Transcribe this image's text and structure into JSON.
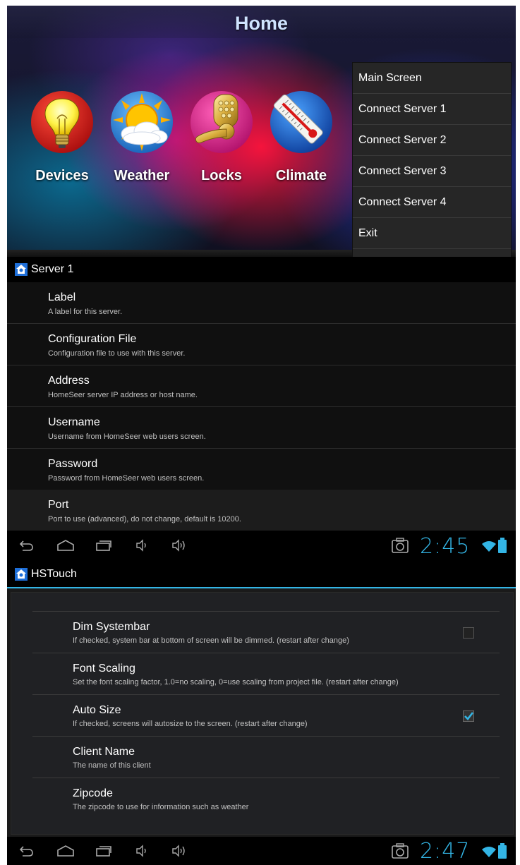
{
  "home": {
    "title": "Home",
    "tiles": [
      {
        "label": "Devices",
        "icon": "lightbulb-icon"
      },
      {
        "label": "Weather",
        "icon": "weather-sun-cloud-icon"
      },
      {
        "label": "Locks",
        "icon": "door-lock-icon"
      },
      {
        "label": "Climate",
        "icon": "thermometer-icon"
      }
    ],
    "menu": [
      "Main Screen",
      "Connect Server 1",
      "Connect Server 2",
      "Connect Server 3",
      "Connect Server 4",
      "Exit"
    ]
  },
  "server_screen": {
    "title": "Server 1",
    "prefs": [
      {
        "title": "Label",
        "summary": "A label for this server."
      },
      {
        "title": "Configuration File",
        "summary": "Configuration file to use with this server."
      },
      {
        "title": "Address",
        "summary": "HomeSeer server IP address or host name."
      },
      {
        "title": "Username",
        "summary": "Username from HomeSeer web users screen."
      },
      {
        "title": "Password",
        "summary": "Password from HomeSeer web users screen."
      },
      {
        "title": "Port",
        "summary": "Port to use (advanced), do not change, default is 10200."
      }
    ],
    "navbar": {
      "time": "2:45"
    }
  },
  "hstouch_screen": {
    "title": "HSTouch",
    "prefs": [
      {
        "title": "Dim Systembar",
        "summary": "If checked, system bar at bottom of screen will be dimmed. (restart after change)",
        "checked": false
      },
      {
        "title": "Font Scaling",
        "summary": "Set the font scaling factor, 1.0=no scaling, 0=use scaling from project file. (restart after change)"
      },
      {
        "title": "Auto Size",
        "summary": "If checked, screens will autosize to the screen. (restart after change)",
        "checked": true
      },
      {
        "title": "Client Name",
        "summary": "The name of this client"
      },
      {
        "title": "Zipcode",
        "summary": "The zipcode to use for information such as weather"
      }
    ],
    "navbar": {
      "time": "2:47"
    }
  },
  "colors": {
    "accent": "#33b5e5",
    "background": "#101010"
  }
}
